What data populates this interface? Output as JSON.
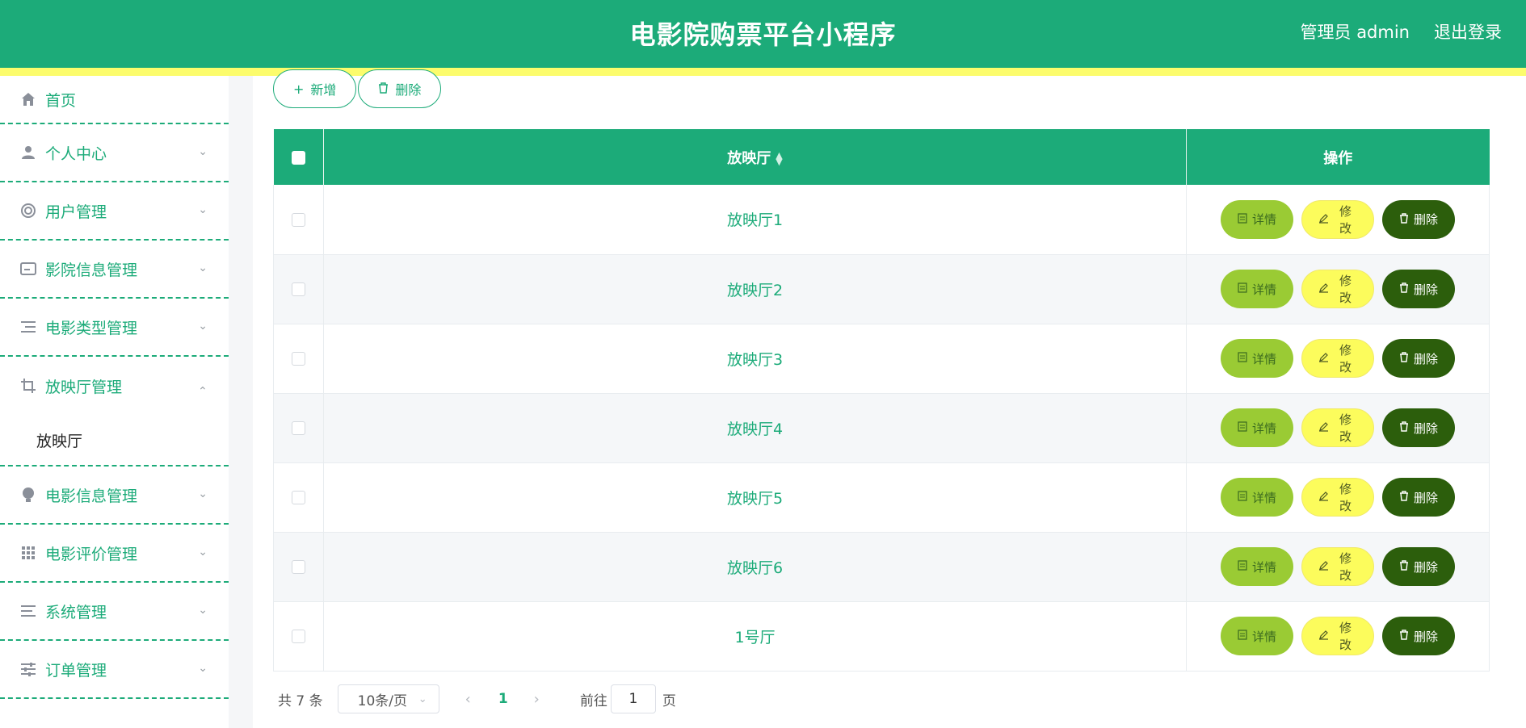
{
  "header": {
    "title": "电影院购票平台小程序",
    "user": "管理员 admin",
    "logout": "退出登录",
    "bg_color": "#1cab79",
    "bar_color": "#fcfc6c"
  },
  "sidebar": {
    "items": [
      {
        "label": "首页",
        "icon": "home-icon"
      },
      {
        "label": "个人中心",
        "icon": "user-icon"
      },
      {
        "label": "用户管理",
        "icon": "lifebuoy-icon"
      },
      {
        "label": "影院信息管理",
        "icon": "id-card-icon"
      },
      {
        "label": "电影类型管理",
        "icon": "list-indent-icon"
      },
      {
        "label": "放映厅管理",
        "icon": "crop-icon",
        "expanded": true,
        "children": [
          {
            "label": "放映厅"
          }
        ]
      },
      {
        "label": "电影信息管理",
        "icon": "bulb-icon"
      },
      {
        "label": "电影评价管理",
        "icon": "grid-icon"
      },
      {
        "label": "系统管理",
        "icon": "list-lines-icon"
      },
      {
        "label": "订单管理",
        "icon": "sliders-icon"
      }
    ]
  },
  "toolbar": {
    "add_label": "新增",
    "delete_label": "删除"
  },
  "table": {
    "columns": [
      "放映厅",
      "操作"
    ],
    "rows": [
      "放映厅1",
      "放映厅2",
      "放映厅3",
      "放映厅4",
      "放映厅5",
      "放映厅6",
      "1号厅"
    ],
    "actions": {
      "detail": "详情",
      "edit": "修改",
      "delete": "删除"
    }
  },
  "pagination": {
    "total_text": "共 7 条",
    "page_size": "10条/页",
    "current_page": "1",
    "goto_label": "前往",
    "goto_value": "1",
    "page_suffix": "页"
  }
}
